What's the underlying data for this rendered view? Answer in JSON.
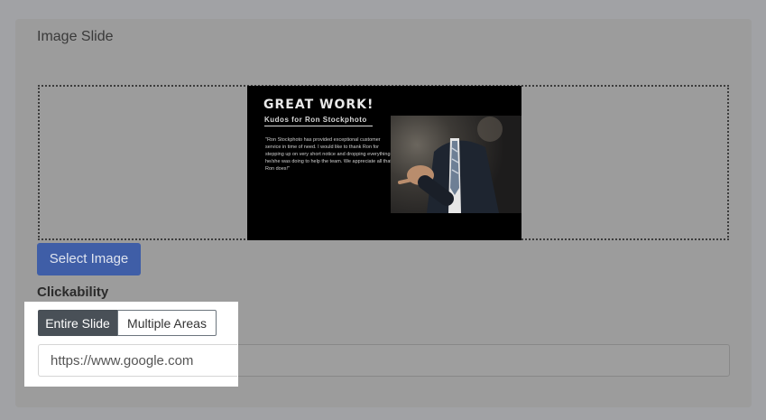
{
  "card": {
    "title": "Image Slide"
  },
  "preview": {
    "title": "GREAT WORK!",
    "subtitle": "Kudos for Ron Stockphoto",
    "quote": "\"Ron Stockphoto has provided exceptional customer service in time of need. I would like to thank Ron for stepping up on very short notice and dropping everything he/she was doing to help the team. We appreciate all that Ron does!\""
  },
  "actions": {
    "select_image_label": "Select Image"
  },
  "clickability": {
    "label": "Clickability",
    "options": [
      "Entire Slide",
      "Multiple Areas"
    ],
    "selected": "Entire Slide",
    "url_value": "https://www.google.com"
  },
  "colors": {
    "primary_button": "#3f5ea7",
    "active_toggle": "#495057",
    "overlay": "#a1a2a5"
  }
}
